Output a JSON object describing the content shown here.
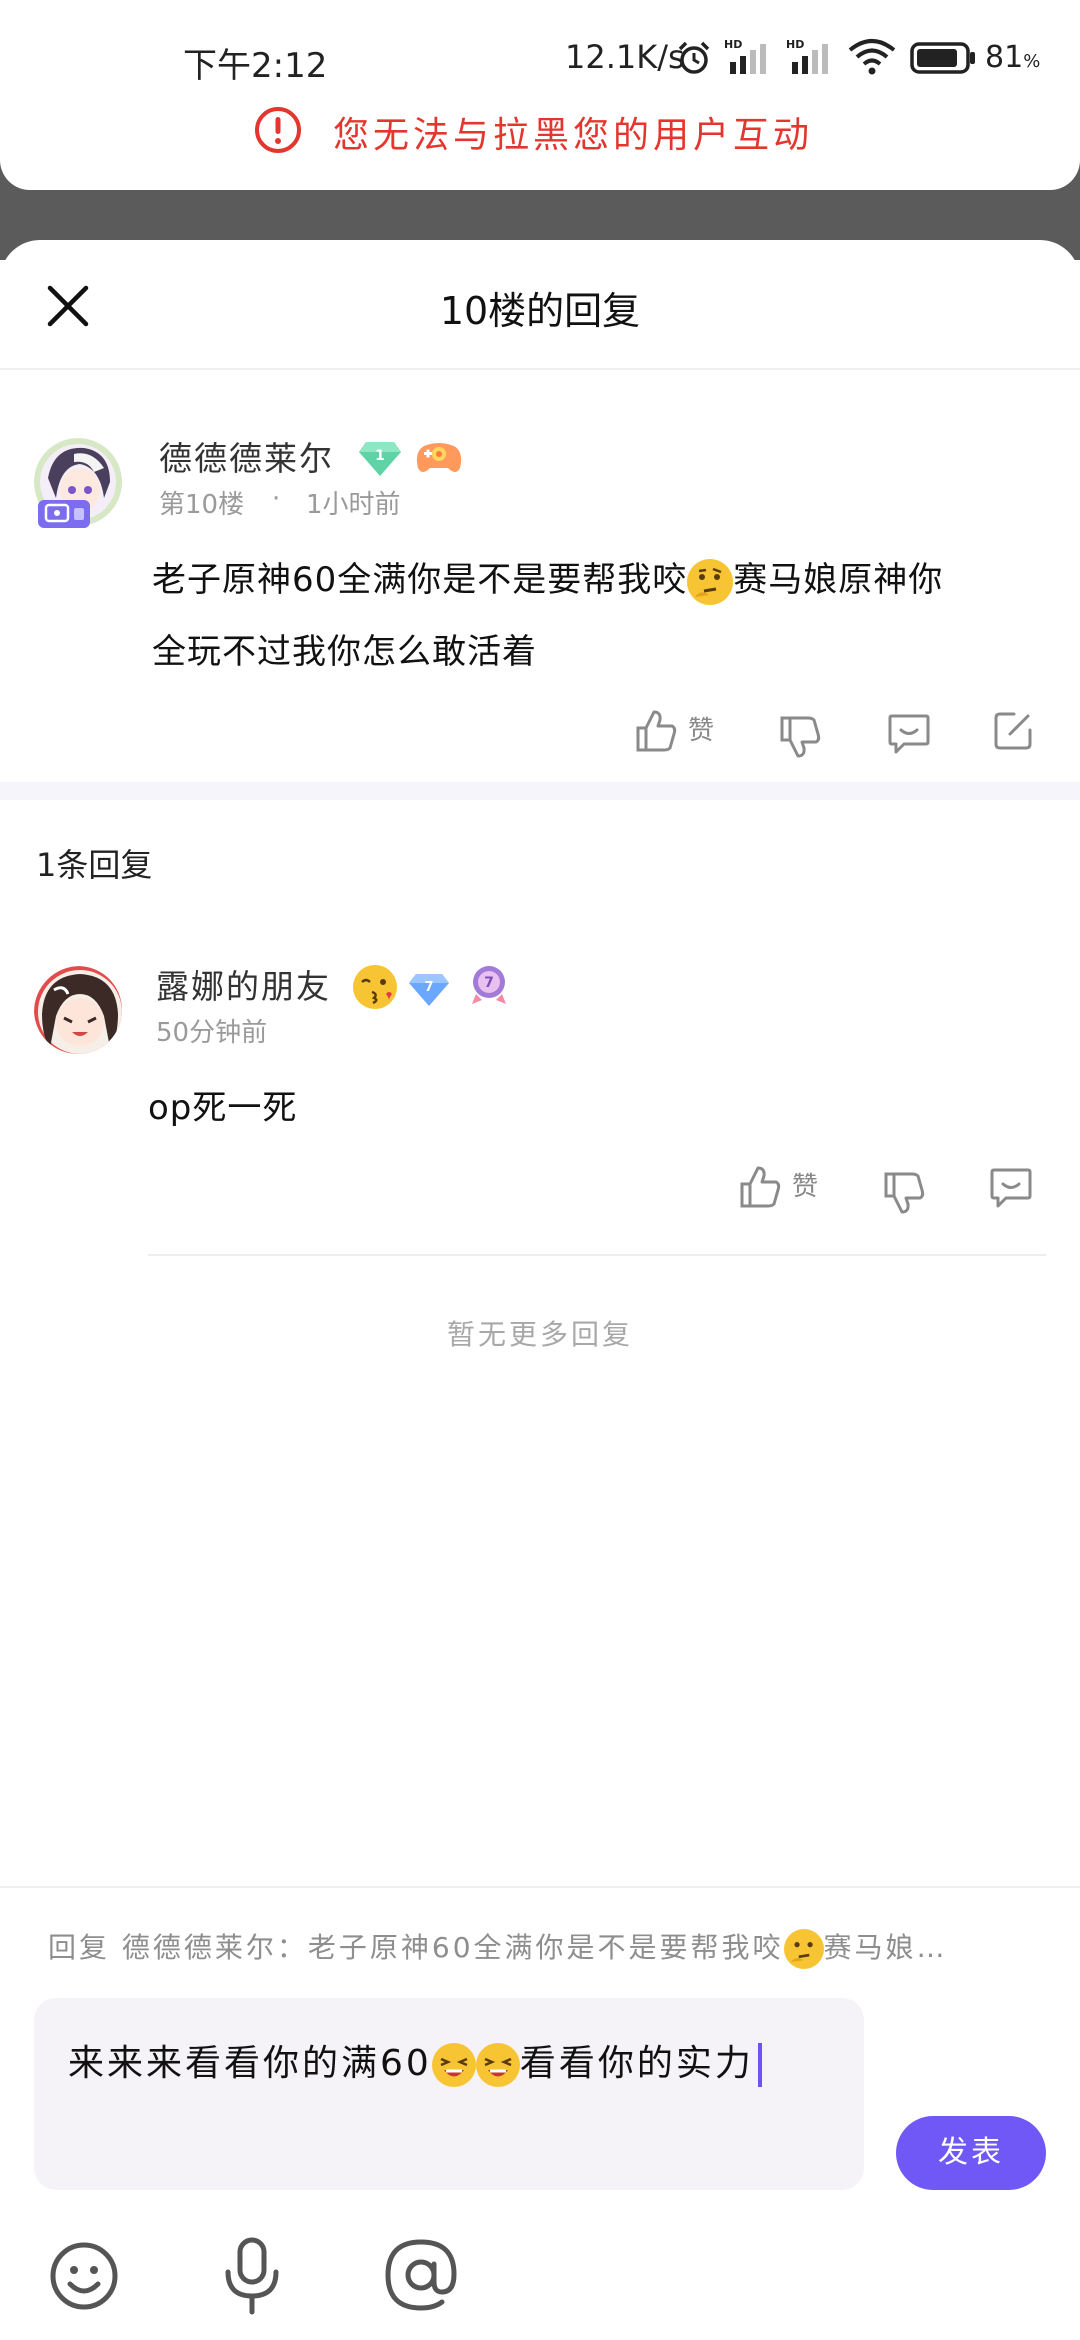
{
  "status_bar": {
    "time": "下午2:12",
    "speed": "12.1K/s",
    "battery": "81"
  },
  "toast": {
    "text": "您无法与拉黑您的用户互动"
  },
  "header": {
    "title": "10楼的回复"
  },
  "post": {
    "author": "德德德莱尔",
    "floor": "第10楼",
    "time": "1小时前",
    "content_line1": "老子原神60全满你是不是要帮我咬",
    "content_line1_tail": "赛马娘原神你",
    "content_line2": "全玩不过我你怎么敢活着",
    "like_label": "赞",
    "badge_level": "1"
  },
  "replies": {
    "count_label": "1条回复",
    "items": [
      {
        "author": "露娜的朋友",
        "time": "50分钟前",
        "content": "op死一死",
        "like_label": "赞",
        "badge_level": "7"
      }
    ],
    "no_more": "暂无更多回复"
  },
  "composer": {
    "reply_hint_prefix": "回复 德德德莱尔：老子原神60全满你是不是要帮我咬",
    "reply_hint_suffix": "赛马娘…",
    "input_text_part1": "来来来看看你的满60",
    "input_text_part2": "看看你的实力",
    "send_label": "发表"
  },
  "colors": {
    "accent": "#7058f7",
    "toast_red": "#e2362e"
  }
}
